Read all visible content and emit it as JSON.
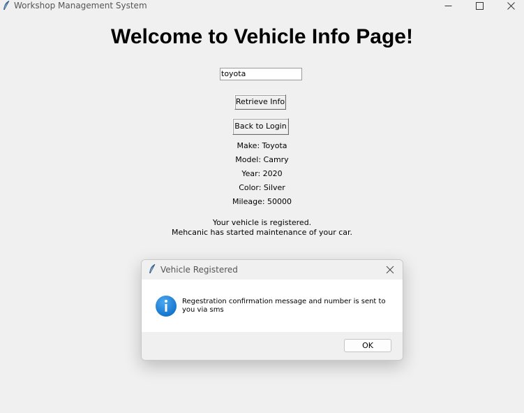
{
  "window": {
    "title": "Workshop Management System",
    "icon": "feather-icon"
  },
  "page": {
    "heading": "Welcome to Vehicle Info Page!",
    "search_value": "toyota",
    "retrieve_label": "Retrieve Info",
    "back_label": "Back to Login",
    "vehicle": {
      "make": "Make: Toyota",
      "model": "Model: Camry",
      "year": "Year: 2020",
      "color": "Color: Silver",
      "mileage": "Mileage: 50000"
    },
    "status_line1": "Your vehicle is registered.",
    "status_line2": "Mehcanic has started maintenance of your car."
  },
  "dialog": {
    "title": "Vehicle Registered",
    "icon": "info-icon",
    "message": "Regestration confirmation message and number is sent to you via sms",
    "ok_label": "OK"
  },
  "colors": {
    "background": "#f0f0f0",
    "info_icon": "#1e88e5"
  }
}
